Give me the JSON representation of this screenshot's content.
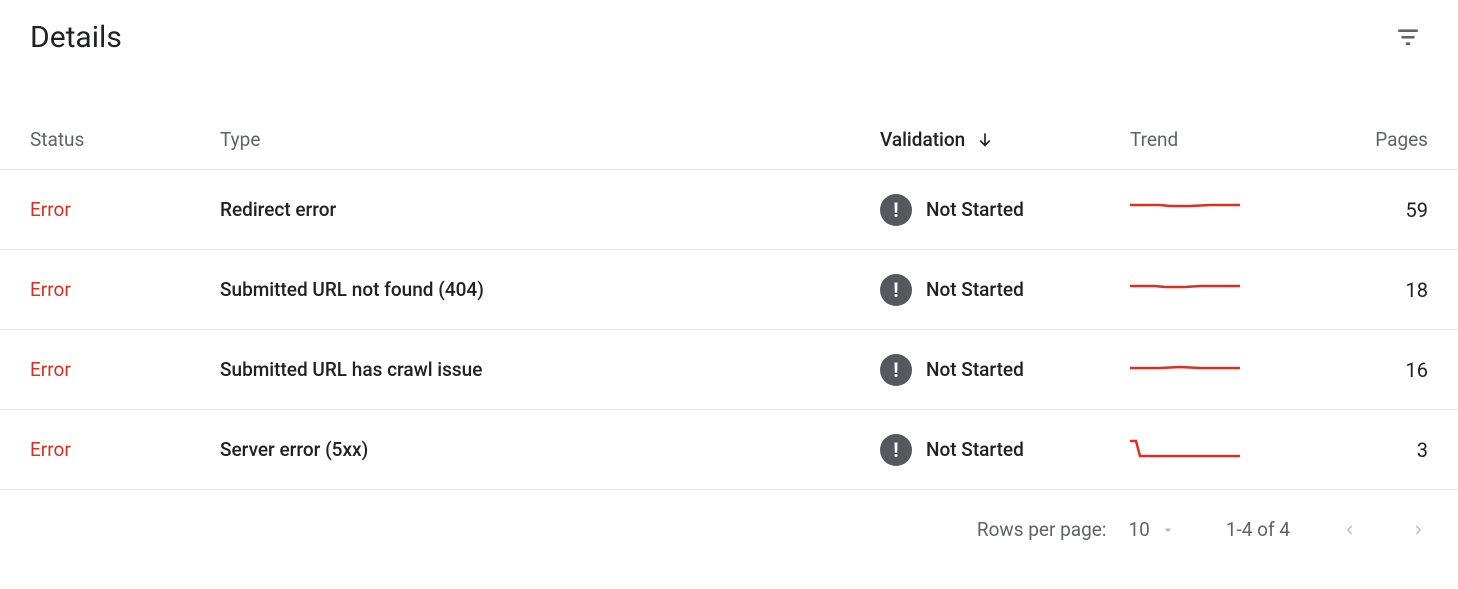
{
  "title": "Details",
  "columns": {
    "status": "Status",
    "type": "Type",
    "validation": "Validation",
    "trend": "Trend",
    "pages": "Pages"
  },
  "sort_column": "validation",
  "rows": [
    {
      "status": "Error",
      "type": "Redirect error",
      "validation": "Not Started",
      "trend": "flat",
      "pages": "59"
    },
    {
      "status": "Error",
      "type": "Submitted URL not found (404)",
      "validation": "Not Started",
      "trend": "flat",
      "pages": "18"
    },
    {
      "status": "Error",
      "type": "Submitted URL has crawl issue",
      "validation": "Not Started",
      "trend": "flat",
      "pages": "16"
    },
    {
      "status": "Error",
      "type": "Server error (5xx)",
      "validation": "Not Started",
      "trend": "drop",
      "pages": "3"
    }
  ],
  "pager": {
    "rows_per_page_label": "Rows per page:",
    "rows_per_page_value": "10",
    "range_label": "1-4 of 4"
  },
  "colors": {
    "error": "#d93025",
    "spark": "#d93025"
  }
}
